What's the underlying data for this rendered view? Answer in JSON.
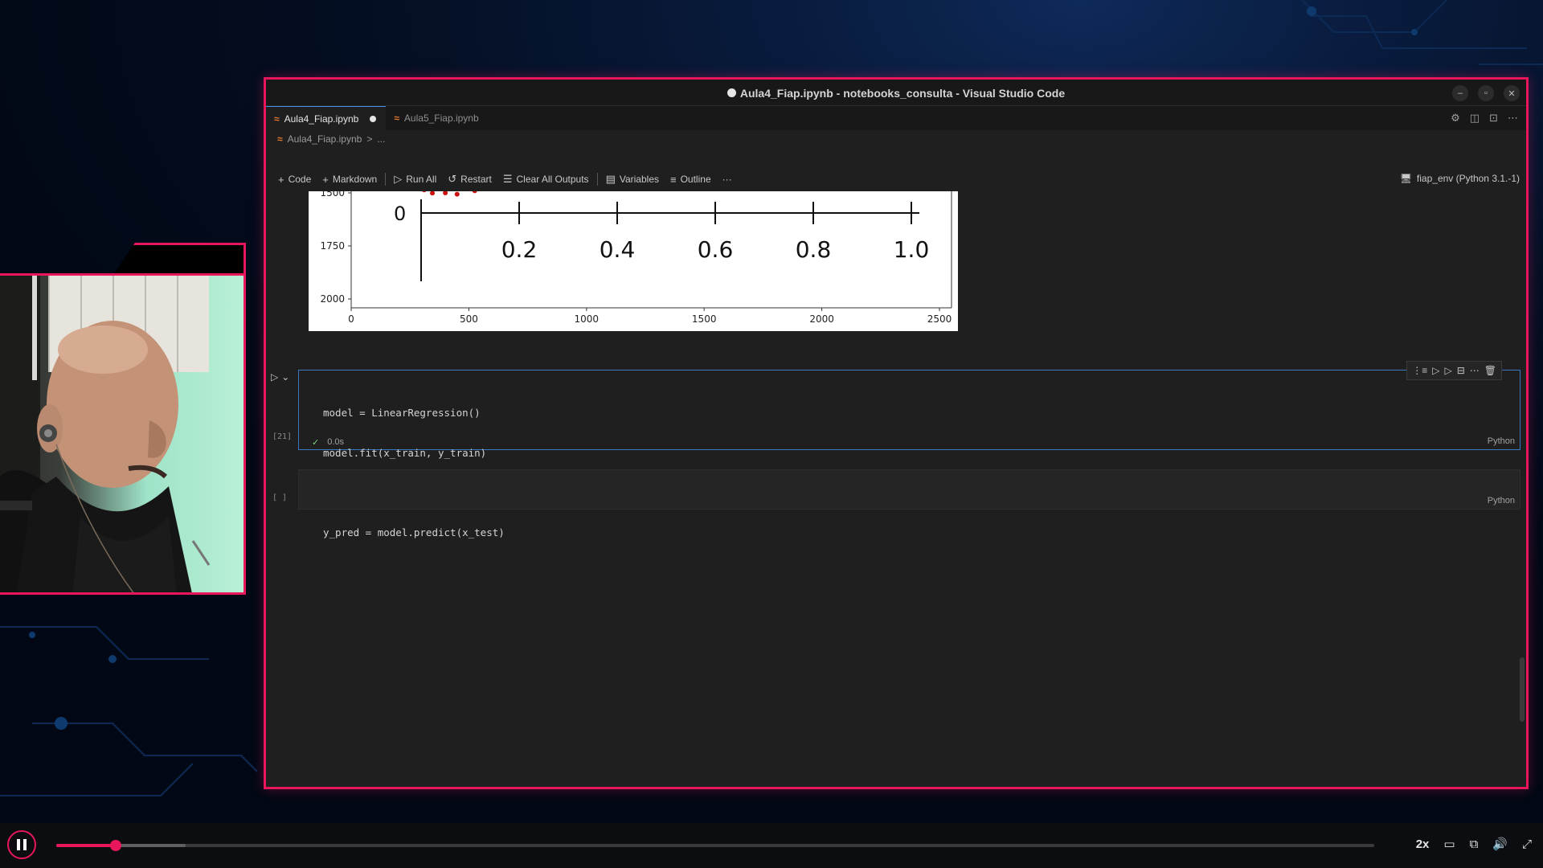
{
  "window": {
    "title": "Aula4_Fiap.ipynb - notebooks_consulta - Visual Studio Code",
    "minimize": "–",
    "restore": "▫",
    "close": "✕"
  },
  "tabs": [
    {
      "label": "Aula4_Fiap.ipynb",
      "active": true,
      "unsaved": true
    },
    {
      "label": "Aula5_Fiap.ipynb",
      "active": false
    }
  ],
  "breadcrumb": {
    "file": "Aula4_Fiap.ipynb",
    "sep": ">",
    "more": "..."
  },
  "toolbar": {
    "code": "Code",
    "markdown": "Markdown",
    "run_all": "Run All",
    "restart": "Restart",
    "clear_outputs": "Clear All Outputs",
    "variables": "Variables",
    "outline": "Outline",
    "more": "···",
    "kernel": "fiap_env (Python 3.1.-1)"
  },
  "chart_data": {
    "type": "scatter",
    "x_ticks": [
      "0",
      "500",
      "1000",
      "1500",
      "2000",
      "2500"
    ],
    "y_ticks": [
      "1500",
      "1750",
      "2000"
    ],
    "inset_x_ticks": [
      "0.2",
      "0.4",
      "0.6",
      "0.8",
      "1.0"
    ],
    "inset_y_label": "0",
    "points_color": "#cc1111",
    "points": [
      [
        310,
        1486
      ],
      [
        345,
        1501
      ],
      [
        395,
        1478
      ],
      [
        400,
        1500
      ],
      [
        450,
        1506
      ],
      [
        525,
        1490
      ]
    ]
  },
  "code_cell": {
    "lines": [
      "model = LinearRegression()",
      "model.fit(x_train, y_train)",
      "",
      "y_pred = model.predict(x_test)"
    ],
    "exec_count": "[21]",
    "duration": "0.0s",
    "language": "Python"
  },
  "empty_cell": {
    "exec_count": "[ ]",
    "language": "Python"
  },
  "player": {
    "speed": "2x",
    "progress": 0.045,
    "buffered": 0.098
  }
}
